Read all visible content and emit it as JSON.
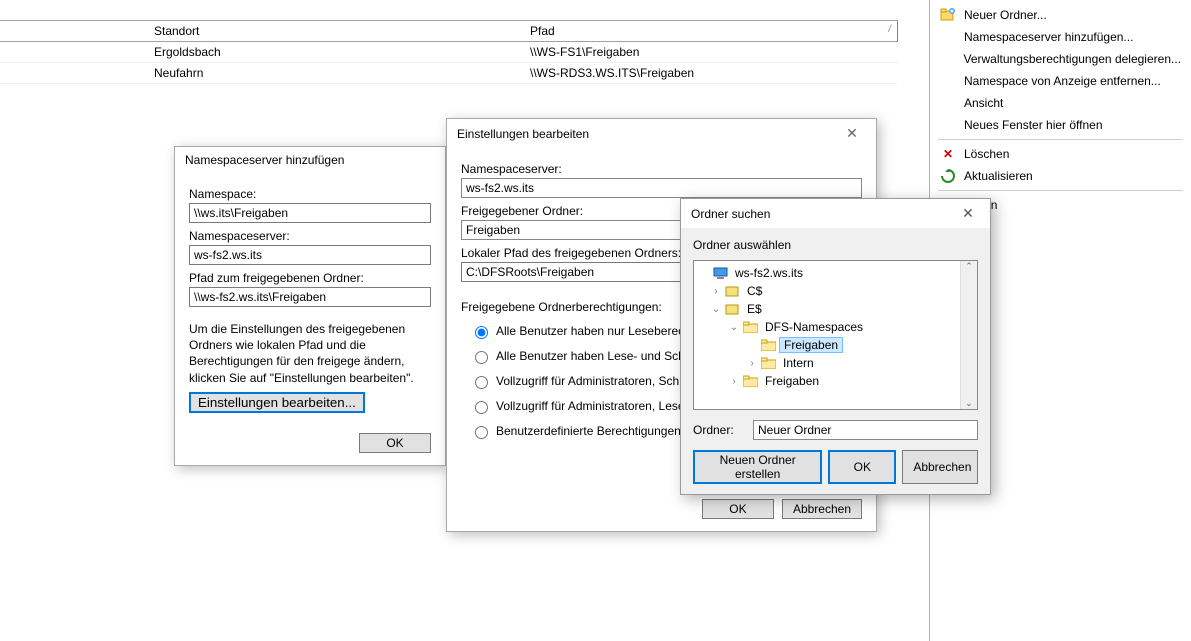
{
  "table": {
    "headers": [
      "",
      "Standort",
      "Pfad"
    ],
    "rows": [
      {
        "c1": "",
        "c2": "Ergoldsbach",
        "c3": "\\\\WS-FS1\\Freigaben"
      },
      {
        "c1": "",
        "c2": "Neufahrn",
        "c3": "\\\\WS-RDS3.WS.ITS\\Freigaben"
      }
    ]
  },
  "actions": {
    "new_folder": "Neuer Ordner...",
    "add_ns_server": "Namespaceserver hinzufügen...",
    "delegate": "Verwaltungsberechtigungen delegieren...",
    "remove_ns": "Namespace von Anzeige entfernen...",
    "view": "Ansicht",
    "new_window": "Neues Fenster hier öffnen",
    "delete": "Löschen",
    "refresh": "Aktualisieren",
    "properties_suffix": "haften"
  },
  "dlg1": {
    "title": "Namespaceserver hinzufügen",
    "ns_label": "Namespace:",
    "ns_value": "\\\\ws.its\\Freigaben",
    "server_label": "Namespaceserver:",
    "server_value": "ws-fs2.ws.its",
    "path_label": "Pfad zum freigegebenen Ordner:",
    "path_value": "\\\\ws-fs2.ws.its\\Freigaben",
    "help": "Um die Einstellungen des freigegebenen Ordners wie lokalen Pfad und die Berechtigungen für den freigege ändern, klicken Sie auf \"Einstellungen bearbeiten\".",
    "edit_button": "Einstellungen bearbeiten...",
    "ok": "OK"
  },
  "dlg2": {
    "title": "Einstellungen bearbeiten",
    "server_label": "Namespaceserver:",
    "server_value": "ws-fs2.ws.its",
    "share_label": "Freigegebener Ordner:",
    "share_value": "Freigaben",
    "local_label": "Lokaler Pfad des freigegebenen Ordners:",
    "local_value": "C:\\DFSRoots\\Freigaben",
    "perms_label": "Freigegebene Ordnerberechtigungen:",
    "r1": "Alle Benutzer haben nur Leseberechtigu",
    "r2": "Alle Benutzer haben Lese- und Schreibb",
    "r3": "Vollzugriff für Administratoren, Schreibbe Benutzer",
    "r4": "Vollzugriff für Administratoren, Lese-/Sch andere Benutzer",
    "r5": "Benutzerdefinierte Berechtigungen verw",
    "ok": "OK",
    "cancel": "Abbrechen"
  },
  "dlg3": {
    "title": "Ordner suchen",
    "subtitle": "Ordner auswählen",
    "tree": {
      "root": "ws-fs2.ws.its",
      "c_drive": "C$",
      "e_drive": "E$",
      "dfs_ns": "DFS-Namespaces",
      "freigaben_sel": "Freigaben",
      "intern": "Intern",
      "freigaben2": "Freigaben"
    },
    "folder_label": "Ordner:",
    "folder_value": "Neuer Ordner",
    "new_folder_btn": "Neuen Ordner erstellen",
    "ok": "OK",
    "cancel": "Abbrechen"
  }
}
